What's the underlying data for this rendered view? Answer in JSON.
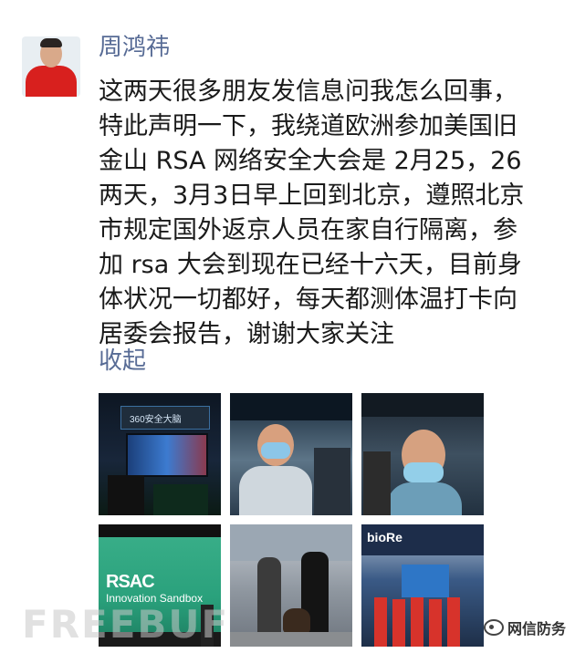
{
  "post": {
    "author": "周鸿祎",
    "text_lines": [
      "这两天很多朋友发信息问我怎么回事，",
      "特此声明一下，我绕道欧洲参加美国旧",
      "金山 RSA 网络安全大会是 2月25，26",
      "两天，3月3日早上回到北京，遵照北京",
      "市规定国外返京人员在家自行隔离，参",
      "加 rsa 大会到现在已经十六天，目前身",
      "体状况一切都好，每天都测体温打卡向",
      "居委会报告，谢谢大家关注"
    ],
    "collapse_label": "收起"
  },
  "photos": {
    "p1": {
      "sign": "360安全大脑",
      "icon": "booth-screen-icon"
    },
    "p4": {
      "line1": "RSAC",
      "line2": "Innovation Sandbox"
    },
    "p6": {
      "sign": "bioRe"
    }
  },
  "watermarks": {
    "freebuf": "FREEBUF",
    "brand_text": "网信防务",
    "brand_icon": "wechat-official-icon"
  },
  "colors": {
    "author_link": "#576b95",
    "body_text": "#1a1a1a"
  }
}
